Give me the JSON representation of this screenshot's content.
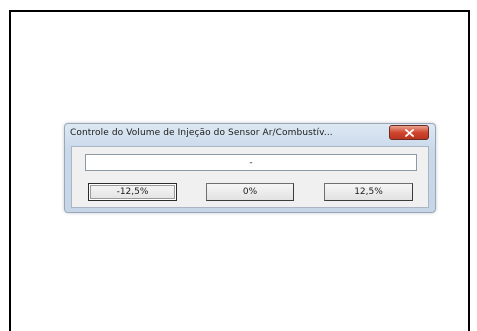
{
  "dialog": {
    "title": "Controle do Volume de Injeção do Sensor Ar/Combustív...",
    "field_value": "-",
    "buttons": {
      "minus_label": "-12,5%",
      "zero_label": "0%",
      "plus_label": "12,5%"
    },
    "close_icon": "close-x-icon",
    "colors": {
      "titlebar": "#c9d9ea",
      "close_button": "#d0472f",
      "client_area": "#f0f0f0"
    }
  }
}
